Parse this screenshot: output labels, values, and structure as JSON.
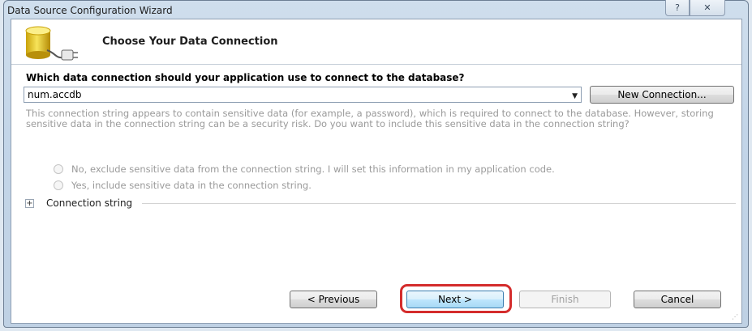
{
  "window": {
    "title": "Data Source Configuration Wizard",
    "help_glyph": "?",
    "close_glyph": "✕"
  },
  "header": {
    "title": "Choose Your Data Connection",
    "icon": "database-plug-icon"
  },
  "connection": {
    "question": "Which data connection should your application use to connect to the database?",
    "selected": "num.accdb",
    "new_connection_label": "New Connection..."
  },
  "sensitive": {
    "description": "This connection string appears to contain sensitive data (for example, a password), which is required to connect to the database. However, storing sensitive data in the connection string can be a security risk. Do you want to include this sensitive data in the connection string?",
    "option_exclude": "No, exclude sensitive data from the connection string. I will set this information in my application code.",
    "option_include": "Yes, include sensitive data in the connection string."
  },
  "connection_string": {
    "expander_glyph": "+",
    "label": "Connection string"
  },
  "footer": {
    "previous_label": "< Previous",
    "next_label": "Next >",
    "finish_label": "Finish",
    "cancel_label": "Cancel"
  },
  "colors": {
    "highlight": "#d42c2c",
    "title_bar": "#c3d5e8"
  }
}
